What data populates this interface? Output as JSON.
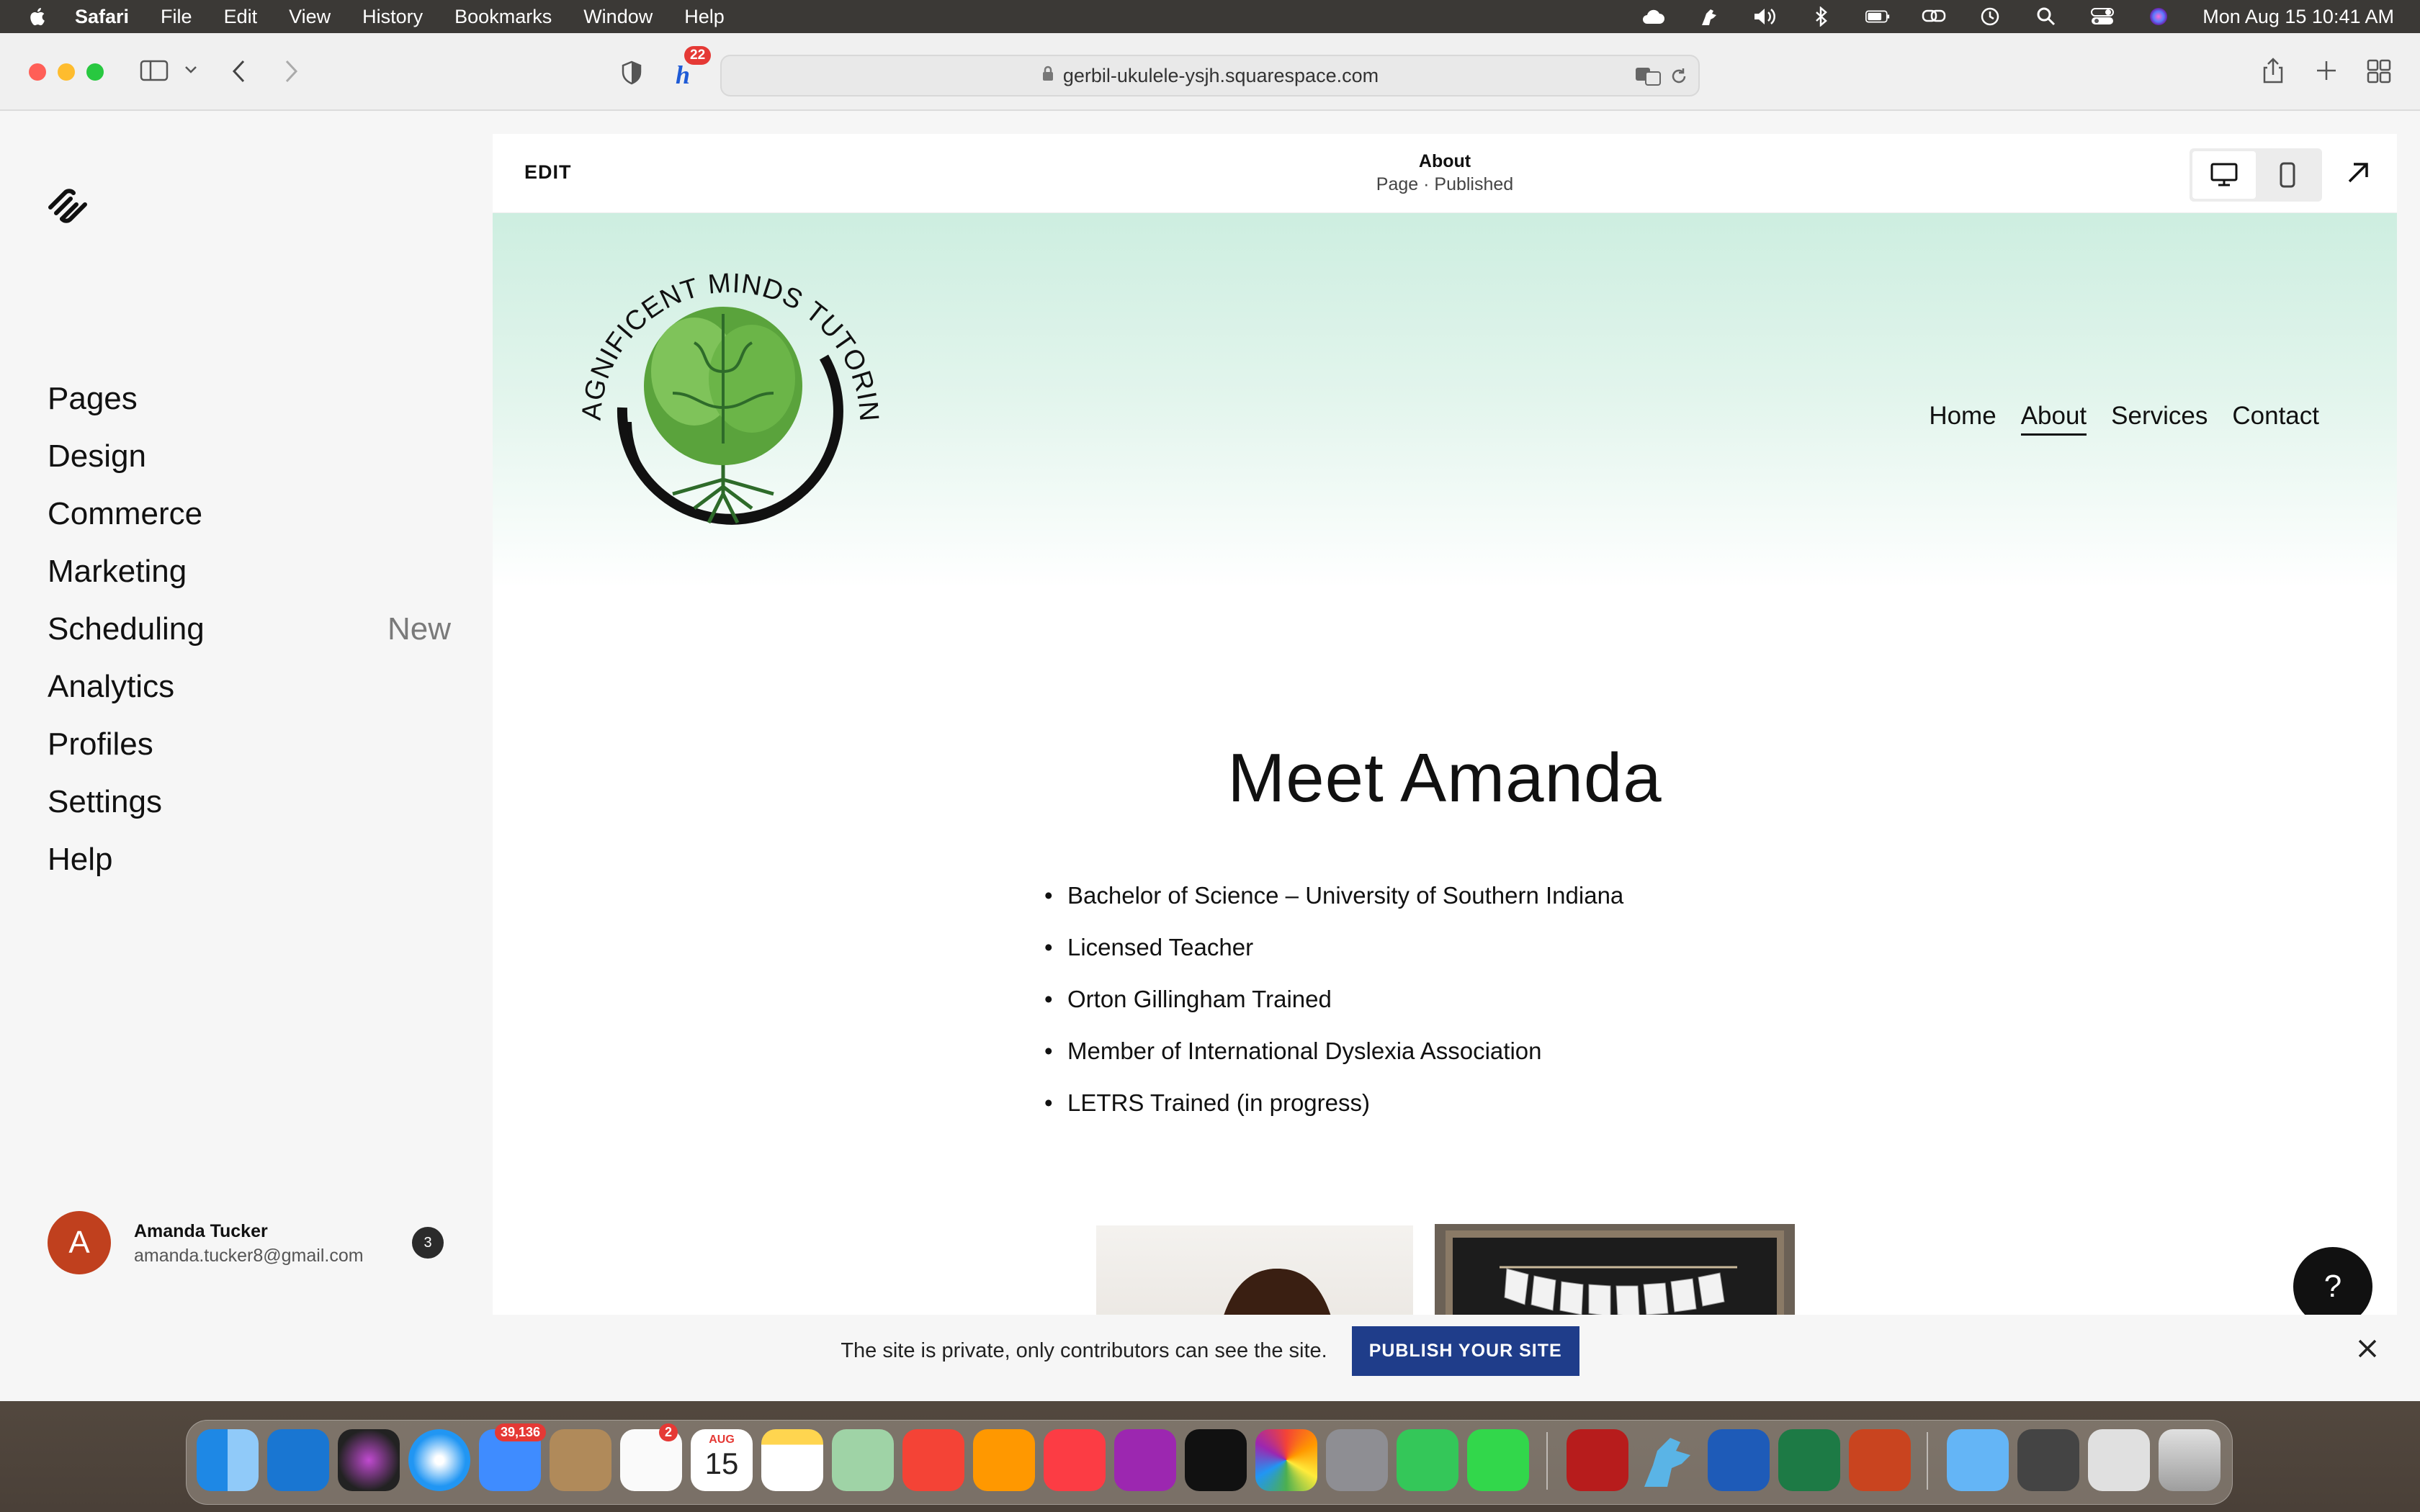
{
  "menubar": {
    "app": "Safari",
    "items": [
      "File",
      "Edit",
      "View",
      "History",
      "Bookmarks",
      "Window",
      "Help"
    ],
    "clock": "Mon Aug 15  10:41 AM"
  },
  "browser": {
    "url": "gerbil-ukulele-ysjh.squarespace.com",
    "extension_badge": "22"
  },
  "sidebar": {
    "nav": [
      {
        "label": "Pages"
      },
      {
        "label": "Design"
      },
      {
        "label": "Commerce"
      },
      {
        "label": "Marketing"
      },
      {
        "label": "Scheduling",
        "tag": "New"
      },
      {
        "label": "Analytics"
      },
      {
        "label": "Profiles"
      },
      {
        "label": "Settings"
      },
      {
        "label": "Help"
      }
    ],
    "user": {
      "initial": "A",
      "name": "Amanda Tucker",
      "email": "amanda.tucker8@gmail.com",
      "notifications": "3"
    }
  },
  "editor": {
    "edit_label": "EDIT",
    "page_title": "About",
    "page_status": "Page · Published"
  },
  "site": {
    "logo_text": "MAGNIFICENT MINDS TUTORING",
    "nav": [
      {
        "label": "Home"
      },
      {
        "label": "About",
        "active": true
      },
      {
        "label": "Services"
      },
      {
        "label": "Contact"
      }
    ],
    "headline": "Meet Amanda",
    "bullets": [
      "Bachelor of Science – University of Southern Indiana",
      "Licensed Teacher",
      "Orton Gillingham Trained",
      "Member of International Dyslexia Association",
      "LETRS Trained (in progress)"
    ],
    "help_label": "?"
  },
  "banner": {
    "message": "The site is private, only contributors can see the site.",
    "publish_label": "PUBLISH YOUR SITE"
  },
  "dock": {
    "mail_badge": "39,136",
    "reminders_badge": "2",
    "calendar_month": "AUG",
    "calendar_day": "15"
  },
  "colors": {
    "publish_button": "#1f3d8a",
    "avatar": "#c0401e",
    "header_gradient": "#cdeee0"
  }
}
